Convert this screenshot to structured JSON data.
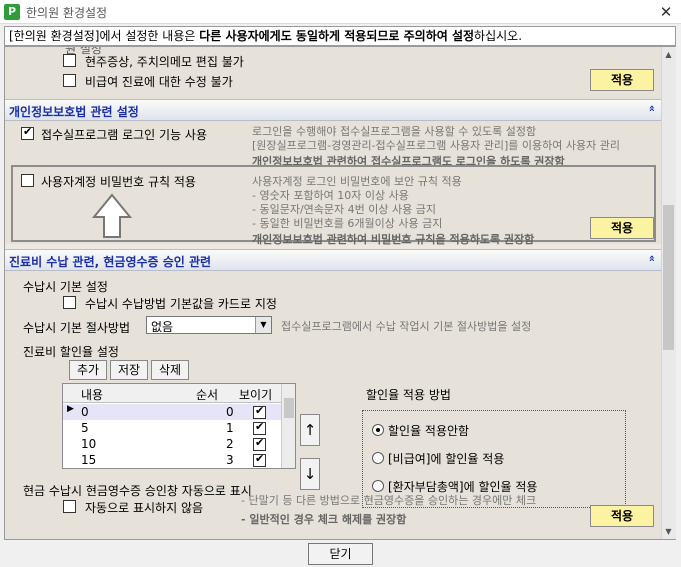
{
  "window": {
    "title": "한의원 환경설정",
    "icon_label": "P",
    "close_glyph": "✕"
  },
  "notice": {
    "part1": "[한의원 환경설정]에서 설정한 내용은 ",
    "part2": "다른 사용자에게도 동일하게 적용되므로 주의하여 설정",
    "part3": "하십시오."
  },
  "top_section": {
    "partial_label": "원 설정",
    "items": [
      {
        "label": "현주증상, 주치의메모 편집 불가",
        "checked": false
      },
      {
        "label": "비급여 진료에 대한 수정 불가",
        "checked": false
      }
    ],
    "apply_label": "적용"
  },
  "privacy_section": {
    "title": "개인정보보호법 관련 설정",
    "collapse_glyph": "»",
    "login_item": {
      "label": "접수실프로그램 로그인 기능 사용",
      "checked": true
    },
    "login_desc": [
      "로그인을 수행해야 접수실프로그램을 사용할 수 있도록 설정함",
      "[원장실프로그램-경영관리-접수실프로그램 사용자 관리]를 이용하여 사용자 관리"
    ],
    "login_desc_bold": "개인정보보호법 관련하여 접수실프로그램도 로그인을 하도록 권장함",
    "password_item": {
      "label": "사용자계정 비밀번호 규칙 적용",
      "checked": false
    },
    "password_desc": [
      "사용자계정 로그인 비밀번호에 보안 규칙 적용",
      " - 영숫자 포함하여 10자 이상 사용",
      " - 동일문자/연속문자 4번 이상 사용 금지",
      " - 동일한 비밀번호를 6개월이상 사용 금지"
    ],
    "password_desc_bold": "개인정보보호법 관련하여 비밀번호 규칙을 적용하도록 권장함",
    "apply_label": "적용"
  },
  "billing_section": {
    "title": "진료비 수납 관련, 현금영수증 승인 관련",
    "collapse_glyph": "»",
    "default_label": "수납시 기본 설정",
    "card_default": {
      "label": "수납시 수납방법 기본값을 카드로 지정",
      "checked": false
    },
    "rounding_label": "수납시 기본 절사방법",
    "rounding_value": "없음",
    "rounding_desc": "접수실프로그램에서 수납 작업시 기본 절사방법을 설정",
    "discount_label": "진료비 할인율 설정",
    "buttons": {
      "add": "추가",
      "save": "저장",
      "delete": "삭제"
    },
    "grid": {
      "columns": [
        "내용",
        "순서",
        "보이기"
      ],
      "rows": [
        {
          "content": "0",
          "order": "0",
          "visible": true
        },
        {
          "content": "5",
          "order": "1",
          "visible": true
        },
        {
          "content": "10",
          "order": "2",
          "visible": true
        },
        {
          "content": "15",
          "order": "3",
          "visible": true
        }
      ]
    },
    "move_up": "↑",
    "move_down": "↓",
    "method_title": "할인율 적용 방법",
    "methods": [
      {
        "label": "할인율 적용안함",
        "selected": true
      },
      {
        "label": "[비급여]에 할인율 적용",
        "selected": false
      },
      {
        "label": "[환자부담총액]에 할인율 적용",
        "selected": false
      }
    ],
    "cash_label": "현금 수납시 현금영수증 승인창 자동으로 표시",
    "cash_item": {
      "label": "자동으로 표시하지 않음",
      "checked": false
    },
    "cash_desc": " - 단말기 등 다른 방법으로 현금영수증을 승인하는 경우에만 체크",
    "cash_desc_bold": " - 일반적인 경우 체크 해제를 권장함",
    "apply_label": "적용"
  },
  "footer": {
    "close_label": "닫기"
  }
}
